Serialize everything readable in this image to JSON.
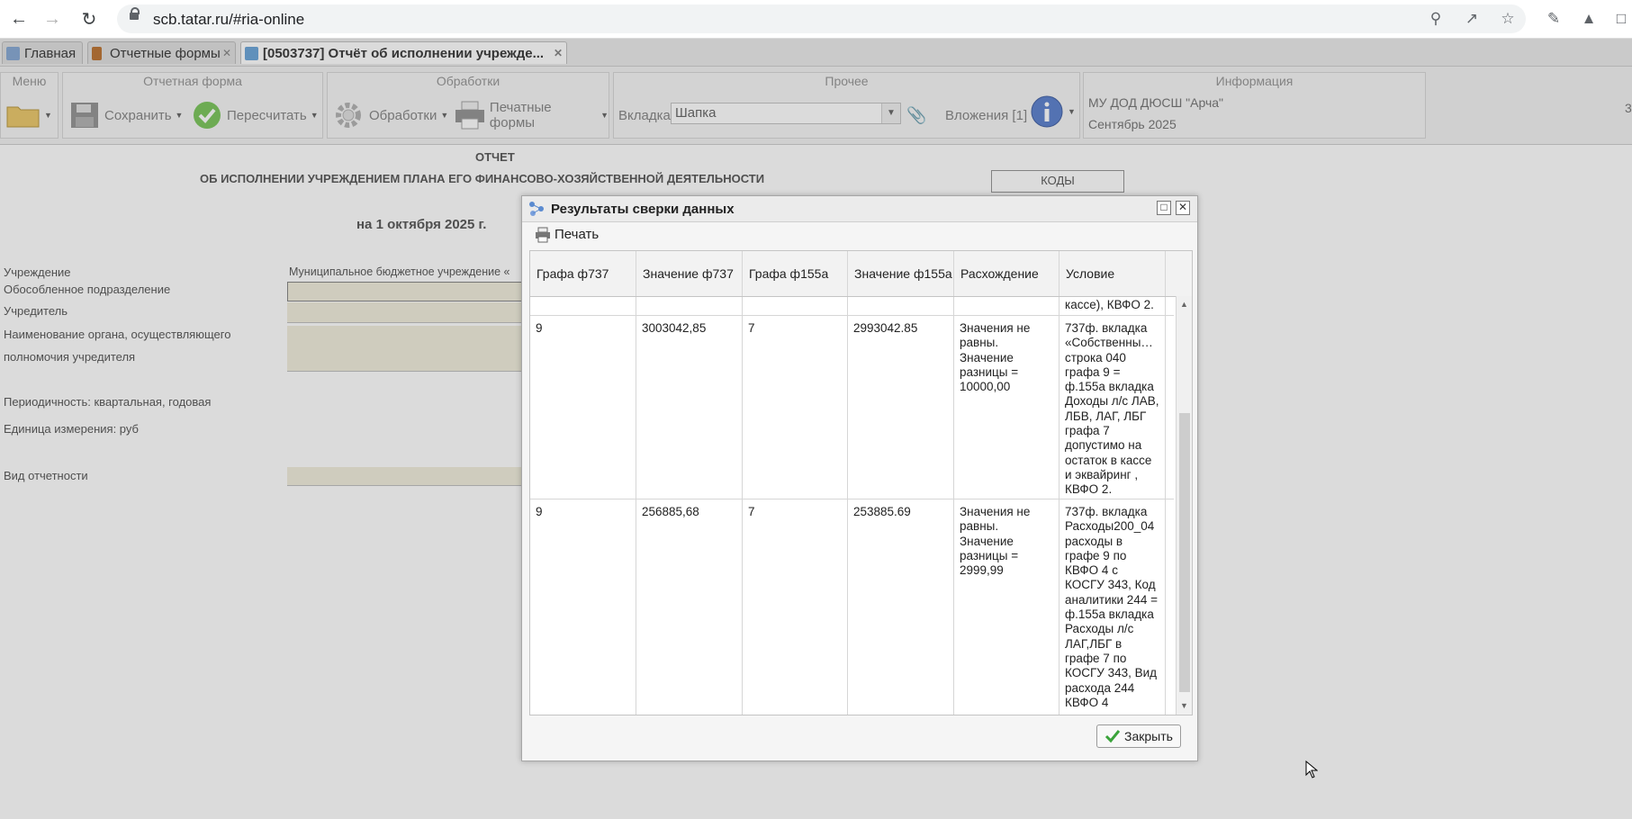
{
  "browser": {
    "url": "scb.tatar.ru/#ria-online"
  },
  "tabs": [
    {
      "label": "Главная"
    },
    {
      "label": "Отчетные формы"
    },
    {
      "label": "[0503737] Отчёт об исполнении учрежде..."
    }
  ],
  "ribbon": {
    "menu_title": "Меню",
    "report_title": "Отчетная форма",
    "save_label": "Сохранить",
    "recalc_label": "Пересчитать",
    "processing_title": "Обработки",
    "processing_label": "Обработки",
    "print_forms_label": "Печатные формы",
    "other_title": "Прочее",
    "tab_label": "Вкладка",
    "tab_value": "Шапка",
    "attachments_label": "Вложения [1]",
    "info_title": "Информация",
    "org": "МУ ДОД ДЮСШ \"Арча\"",
    "period": "Сентябрь 2025",
    "edge_char": "3"
  },
  "form": {
    "title1": "ОТЧЕТ",
    "title2": "ОБ ИСПОЛНЕНИИ УЧРЕЖДЕНИЕМ ПЛАНА ЕГО ФИНАНСОВО-ХОЗЯЙСТВЕННОЙ ДЕЯТЕЛЬНОСТИ",
    "date": "на 1 октября 2025 г.",
    "codes": "КОДЫ",
    "institution_label": "Учреждение",
    "institution_value": "Муниципальное бюджетное учреждение «",
    "subdivision_label": "Обособленное подразделение",
    "founder_label": "Учредитель",
    "authority_label1": "Наименование органа, осуществляющего",
    "authority_label2": "полномочия учредителя",
    "periodicity_label": "Периодичность: квартальная, годовая",
    "unit_label": "Единица измерения: руб",
    "report_type_label": "Вид отчетности"
  },
  "dialog": {
    "title": "Результаты сверки данных",
    "print_label": "Печать",
    "columns": [
      "Графа ф737",
      "Значение ф737",
      "Графа ф155а",
      "Значение ф155а",
      "Расхождение",
      "Условие"
    ],
    "partial_row": {
      "condition": "кассе), КВФО 2."
    },
    "rows": [
      {
        "col737": "9",
        "val737": "3003042,85",
        "col155": "7",
        "val155": "2993042.85",
        "diff": "Значения не равны. Значение разницы = 10000,00",
        "condition": "737ф. вкладка «Собственны… строка 040 графа 9 = ф.155а вкладка Доходы л/с ЛАВ, ЛБВ, ЛАГ, ЛБГ графа 7 допустимо на остаток в кассе и эквайринг , КВФО 2."
      },
      {
        "col737": "9",
        "val737": "256885,68",
        "col155": "7",
        "val155": "253885.69",
        "diff": "Значения не равны. Значение разницы = 2999,99",
        "condition": "737ф. вкладка Расходы200_04 расходы в графе 9 по КВФО 4 с КОСГУ 343, Код аналитики 244 = ф.155а вкладка Расходы л/с ЛАГ,ЛБГ в графе 7 по КОСГУ 343, Вид расхода 244 КВФО 4"
      }
    ],
    "close_label": "Закрыть"
  }
}
